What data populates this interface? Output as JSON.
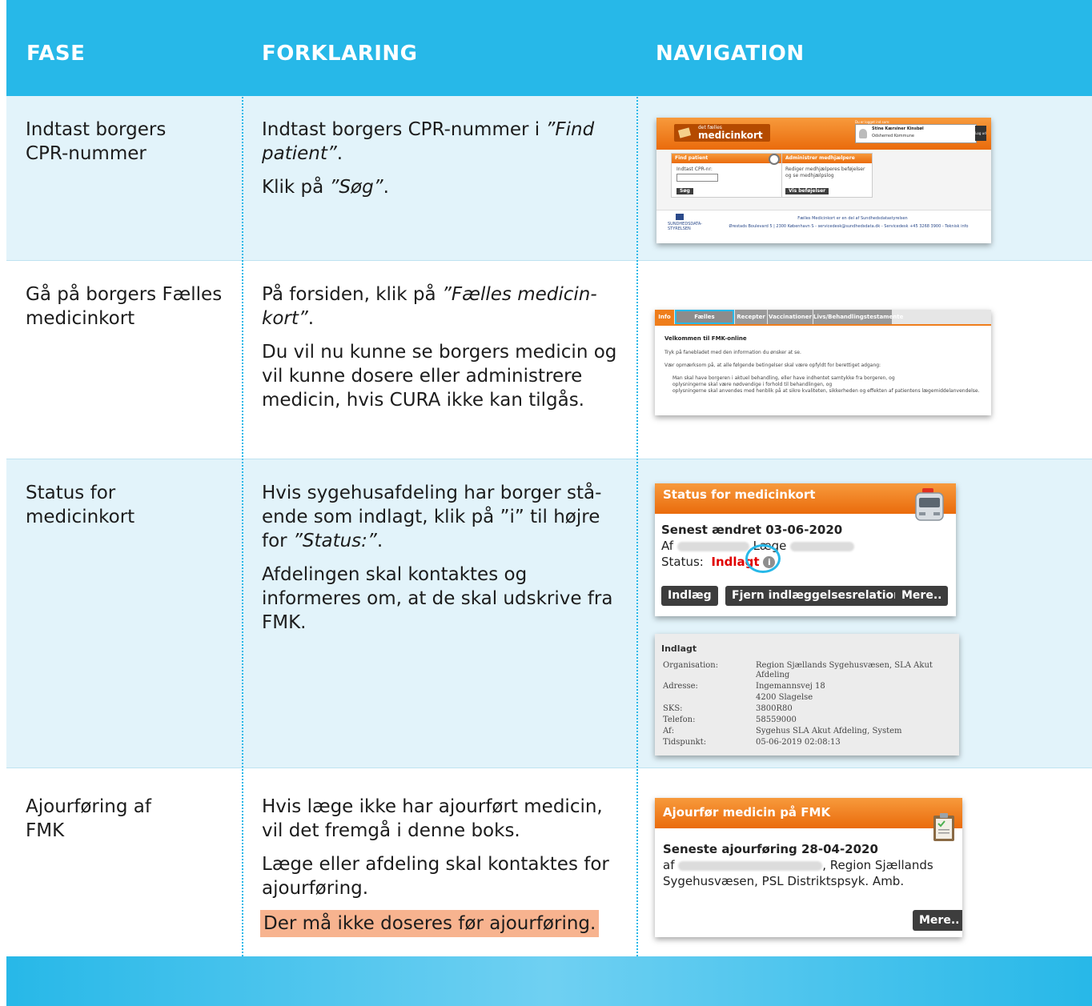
{
  "header": {
    "fase": "FASE",
    "forklaring": "FORKLARING",
    "navigation": "NAVIGATION"
  },
  "rows": [
    {
      "phase": "Indtast borgers CPR-nummer",
      "p1a": "Indtast borgers CPR-nummer i ",
      "p1b": "”Find patient”",
      "p1c": ".",
      "p2a": "Klik på ",
      "p2b": "”Søg”",
      "p2c": "."
    },
    {
      "phase": "Gå på borgers Fælles medicinkort",
      "p1a": "På forsiden, klik på ",
      "p1b": "”Fælles medicin­kort”",
      "p1c": ".",
      "p2": "Du vil nu kunne se borgers medicin og vil kunne dosere eller admini­strere medicin, hvis CURA ikke kan tilgås."
    },
    {
      "phase": "Status for medicinkort",
      "p1a": "Hvis sygehusafdeling har borger stå­ende som indlagt, klik på ”i” til højre for ",
      "p1b": "”Status:”",
      "p1c": ".",
      "p2": "Afdelingen skal kontaktes og informeres om, at de skal udskrive fra FMK."
    },
    {
      "phase": "Ajourføring af FMK",
      "p1": "Hvis læge ikke har ajourført medicin, vil det fremgå i denne boks.",
      "p2": "Læge eller afdeling skal kontaktes for ajourføring.",
      "warning": "Der må ikke doseres før ajourføring."
    }
  ],
  "shot1": {
    "logo_small": "det fælles",
    "logo_big": "medicinkort",
    "logged_in_label": "Du er logget ind som:",
    "user_name": "Stine Kærsiner Kinsbøl",
    "user_org": "Odsherred Kommune",
    "logout": "Log ud",
    "box1_title": "Find patient",
    "cpr_label": "Indtast CPR-nr:",
    "search_button": "Søg",
    "box2_title": "Administrer medhjælpere",
    "box2_text": "Rediger medhjælperes beføjelser og se medhjælpslog",
    "box2_button": "Vis beføjelser",
    "footer_logo": "SUNDHEDSDATA-STYRELSEN",
    "footer_line1": "Fælles Medicinkort er en del af Sundhedsdatastyrelsen",
    "footer_line2": "Ørestads Boulevard 5 | 2300 København S - servicedesk@sundhedsdata.dk - Servicedesk +45 3268 3900 - Teknisk info"
  },
  "shot2": {
    "tabs": [
      "Info",
      "Fælles medicinkort",
      "Recepter",
      "Vaccinationer",
      "Livs/Behandlingstestamente"
    ],
    "title": "Velkommen til FMK-online",
    "line1": "Tryk på fanebladet med den information du ønsker at se.",
    "line2": "Vær opmærksom på, at alle følgende betingelser skal være opfyldt for berettiget adgang:",
    "bullet1": "Man skal have borgeren i aktuel behandling, eller have indhentet samtykke fra borgeren, og",
    "bullet2": "oplysningerne skal være nødvendige i forhold til behandlingen, og",
    "bullet3": "oplysningerne skal anvendes med henblik på at sikre kvaliteten, sikkerheden og effekten af patientens lægemiddelanvendelse."
  },
  "shot3": {
    "title": "Status for medicinkort",
    "changed": "Senest ændret 03-06-2020",
    "af": "Af",
    "laege": "Læge",
    "status_label": "Status:",
    "status_value": "Indlagt",
    "btn1": "Indlæg",
    "btn2": "Fjern indlæggelsesrelation",
    "btn3": "Mere.."
  },
  "shot4": {
    "title": "Indlagt",
    "rows": [
      {
        "k": "Organisation:",
        "v": "Region Sjællands Sygehusvæsen, SLA Akut Afdeling"
      },
      {
        "k": "Adresse:",
        "v": "Ingemannsvej 18"
      },
      {
        "k": "",
        "v": "4200 Slagelse"
      },
      {
        "k": "SKS:",
        "v": "3800R80"
      },
      {
        "k": "Telefon:",
        "v": "58559000"
      },
      {
        "k": "Af:",
        "v": "Sygehus SLA Akut Afdeling, System"
      },
      {
        "k": "Tidspunkt:",
        "v": "05-06-2019 02:08:13"
      }
    ]
  },
  "shot5": {
    "title": "Ajourfør medicin på FMK",
    "latest": "Seneste ajourføring 28-04-2020",
    "af": "af",
    "region": ", Region Sjællands",
    "line3": "Sygehusvæsen, PSL Distriktspsyk. Amb.",
    "more": "Mere.."
  },
  "colors": {
    "header": "#27b8e8",
    "row_tint": "#e2f3fa",
    "fmk_orange": "#ef7d1b",
    "warning_bg": "#f7b38f",
    "status_red": "#e00000"
  }
}
